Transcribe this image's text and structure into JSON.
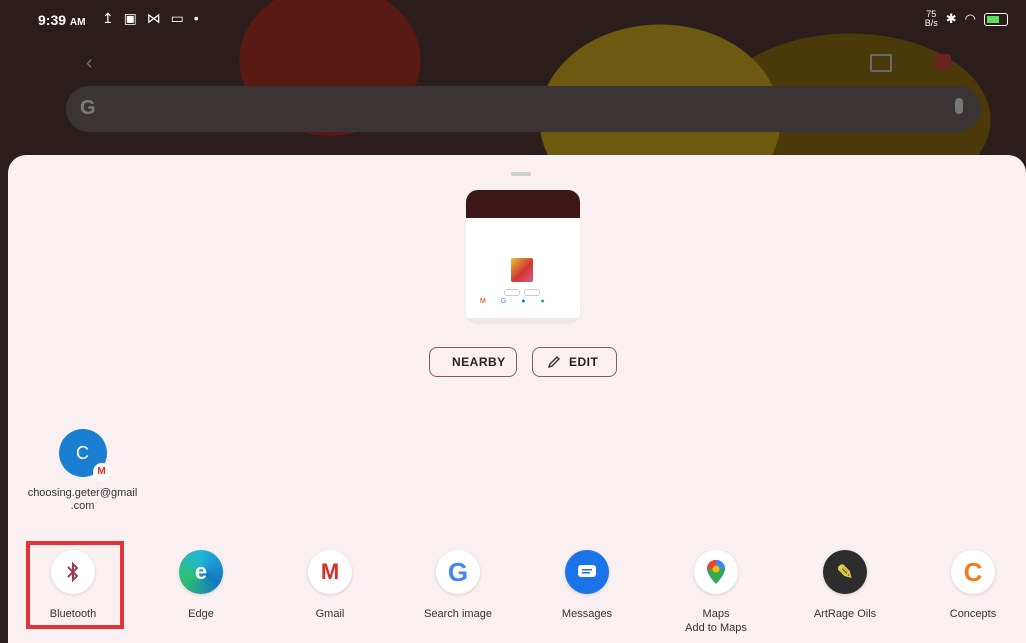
{
  "status_bar": {
    "time": "9:39",
    "ampm": "AM",
    "left_icons": "↥ ▣ ⋈ ▭ •",
    "speed": "75",
    "speed_unit": "B/s"
  },
  "background_app": {
    "search_logo": "G"
  },
  "share_sheet": {
    "nearby_label": "NEARBY",
    "edit_label": "EDIT"
  },
  "contact": {
    "initial": "C",
    "name": "choosing.geter@gmail .com"
  },
  "apps": [
    {
      "label": "Bluetooth",
      "sublabel": "",
      "icon": "bluetooth-icon",
      "color": "#9b3b5a"
    },
    {
      "label": "Edge",
      "sublabel": "",
      "icon": "edge-icon",
      "color": "#1577c4"
    },
    {
      "label": "Gmail",
      "sublabel": "",
      "icon": "gmail-icon",
      "color": "#d93025"
    },
    {
      "label": "Search image",
      "sublabel": "",
      "icon": "google-icon",
      "color": "#4285f4"
    },
    {
      "label": "Messages",
      "sublabel": "",
      "icon": "messages-icon",
      "color": "#1a73e8"
    },
    {
      "label": "Maps",
      "sublabel": "Add to Maps",
      "icon": "maps-icon",
      "color": "#34a853"
    },
    {
      "label": "ArtRage Oils",
      "sublabel": "",
      "icon": "artrage-icon",
      "color": "#2d2d2d"
    },
    {
      "label": "Concepts",
      "sublabel": "",
      "icon": "concepts-icon",
      "color": "#f47b20"
    }
  ],
  "highlight_color": "#e0343a"
}
